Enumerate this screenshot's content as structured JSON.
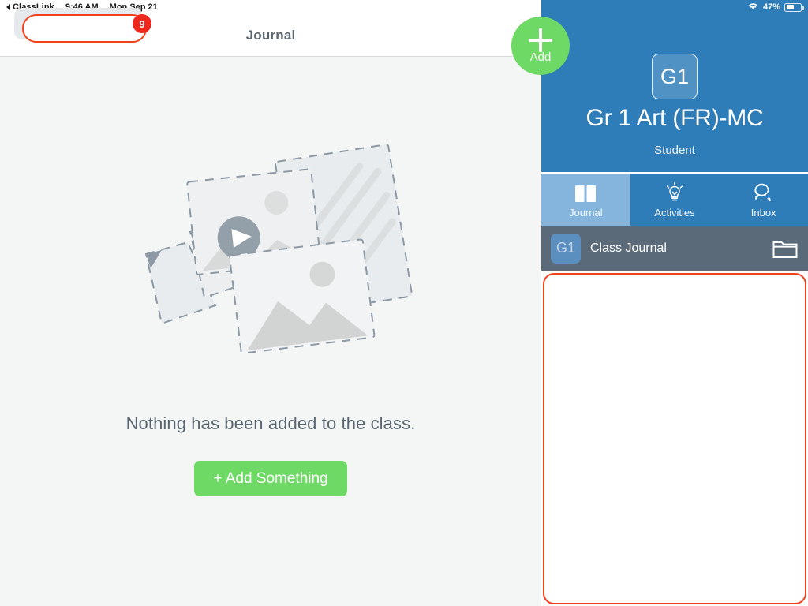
{
  "status_bar": {
    "back_label": "ClassLink",
    "back_icon": "triangle-left-icon",
    "time": "9:46 AM",
    "date": "Mon Sep 21",
    "wifi_icon": "wifi-icon",
    "battery_percent": "47%",
    "battery_icon": "battery-icon"
  },
  "left_pane": {
    "header": {
      "title": "Journal",
      "back_button_badge": "9"
    },
    "empty_state": {
      "illustration": "empty-media-cards-illustration",
      "message": "Nothing has been added to the class.",
      "add_button_label": "+ Add Something"
    }
  },
  "add_fab": {
    "label": "Add",
    "icon": "plus-icon"
  },
  "right_pane": {
    "class": {
      "avatar_initials": "G1",
      "name": "Gr 1 Art (FR)-MC",
      "role": "Student"
    },
    "tabs": [
      {
        "label": "Journal",
        "icon": "open-book-icon",
        "active": true
      },
      {
        "label": "Activities",
        "icon": "lightbulb-icon",
        "active": false
      },
      {
        "label": "Inbox",
        "icon": "chat-bubbles-icon",
        "active": false
      }
    ],
    "journal_bar": {
      "avatar_initials": "G1",
      "label": "Class Journal",
      "folder_icon": "folder-icon"
    },
    "feed": {
      "items": []
    }
  },
  "colors": {
    "blue": "#2e7cb8",
    "blue_active_tab": "#85b5dc",
    "gray_bar": "#5b6a78",
    "green": "#6ed964",
    "highlight_red": "#f1411c",
    "badge_red": "#f0271d",
    "text_gray": "#5b6770"
  }
}
